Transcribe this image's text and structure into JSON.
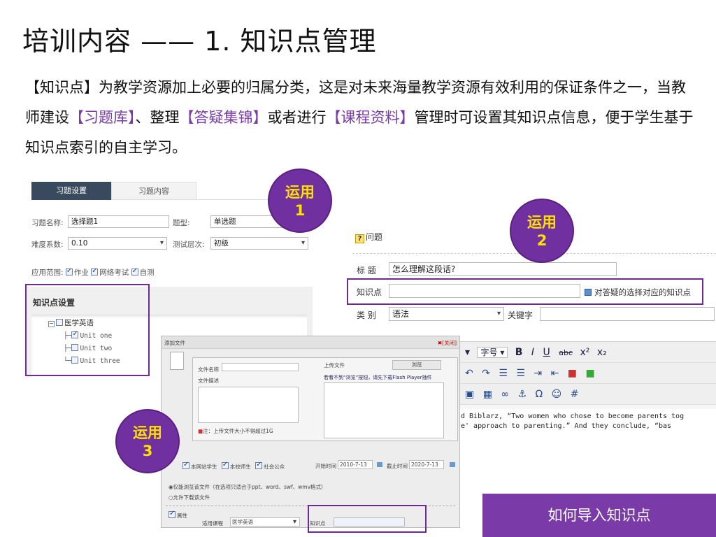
{
  "title": "培训内容 —— 1. 知识点管理",
  "intro": {
    "p1": "【知识点】为教学资源加上必要的归属分类，这是对未来海量教学资源有效利用的保证条件之一，当教师建设",
    "l1": "【习题库】",
    "p2": "、整理",
    "l2": "【答疑集锦】",
    "p3": "或者进行",
    "l3": "【课程资料】",
    "p4": "管理时可设置其知识点信息，便于学生基于知识点索引的自主学习。"
  },
  "shot1": {
    "tab_active": "习题设置",
    "tab_other": "习题内容",
    "name_label": "习题名称:",
    "name_value": "选择题1",
    "type_label": "题型:",
    "type_value": "单选题",
    "diff_label": "难度系数:",
    "diff_value": "0.10",
    "level_label": "测试层次:",
    "level_value": "初级",
    "scope_label": "应用范围:",
    "scope_1": "作业",
    "scope_2": "网络考试",
    "scope_3": "自测"
  },
  "tree": {
    "header": "知识点设置",
    "root": "医学英语",
    "units": [
      "Unit one",
      "Unit two",
      "Unit three"
    ]
  },
  "shot2": {
    "header": "问题",
    "title_label": "标 题",
    "title_value": "怎么理解这段话?",
    "kp_label": "知识点",
    "kp_hint": "对答疑的选择对应的知识点",
    "cat_label": "类 别",
    "cat_value": "语法",
    "kw_label": "关键字"
  },
  "editor": {
    "font_size": "字号",
    "text1": "d Biblarz, “Two women who chose to become parents tog",
    "text2": "e' approach to parenting.” And they conclude, “bas"
  },
  "dialog": {
    "title": "添加文件",
    "close": "[关闭]",
    "file_name": "文件名称",
    "file_desc": "文件描述",
    "upload": "上传文件",
    "browse": "浏览",
    "hint": "若看不到“浏览”按钮，请先下载Flash Player插件",
    "note": "注：上传文件大小不得超过1G",
    "aud1": "本网站学生",
    "aud2": "本校师生",
    "aud3": "社会公众",
    "start_label": "开始时间",
    "start": "2010-7-13",
    "end_label": "截止时间",
    "end": "2020-7-13",
    "opt1": "仅能浏览该文件（在选项只适合于ppt、word、swf、wmv格式）",
    "opt2": "允许下载该文件",
    "attr": "属性",
    "course_label": "适用课程",
    "course": "医学英语",
    "kp_label": "知识点"
  },
  "badges": {
    "b1": [
      "运用",
      "1"
    ],
    "b2": [
      "运用",
      "2"
    ],
    "b3": [
      "运用",
      "3"
    ]
  },
  "how_button": "如何导入知识点",
  "colors": {
    "purple": "#7030a0",
    "badge_text": "#ffe000",
    "highlight_text": "#7a3aa8",
    "tab_dark": "#3a4a5e"
  }
}
